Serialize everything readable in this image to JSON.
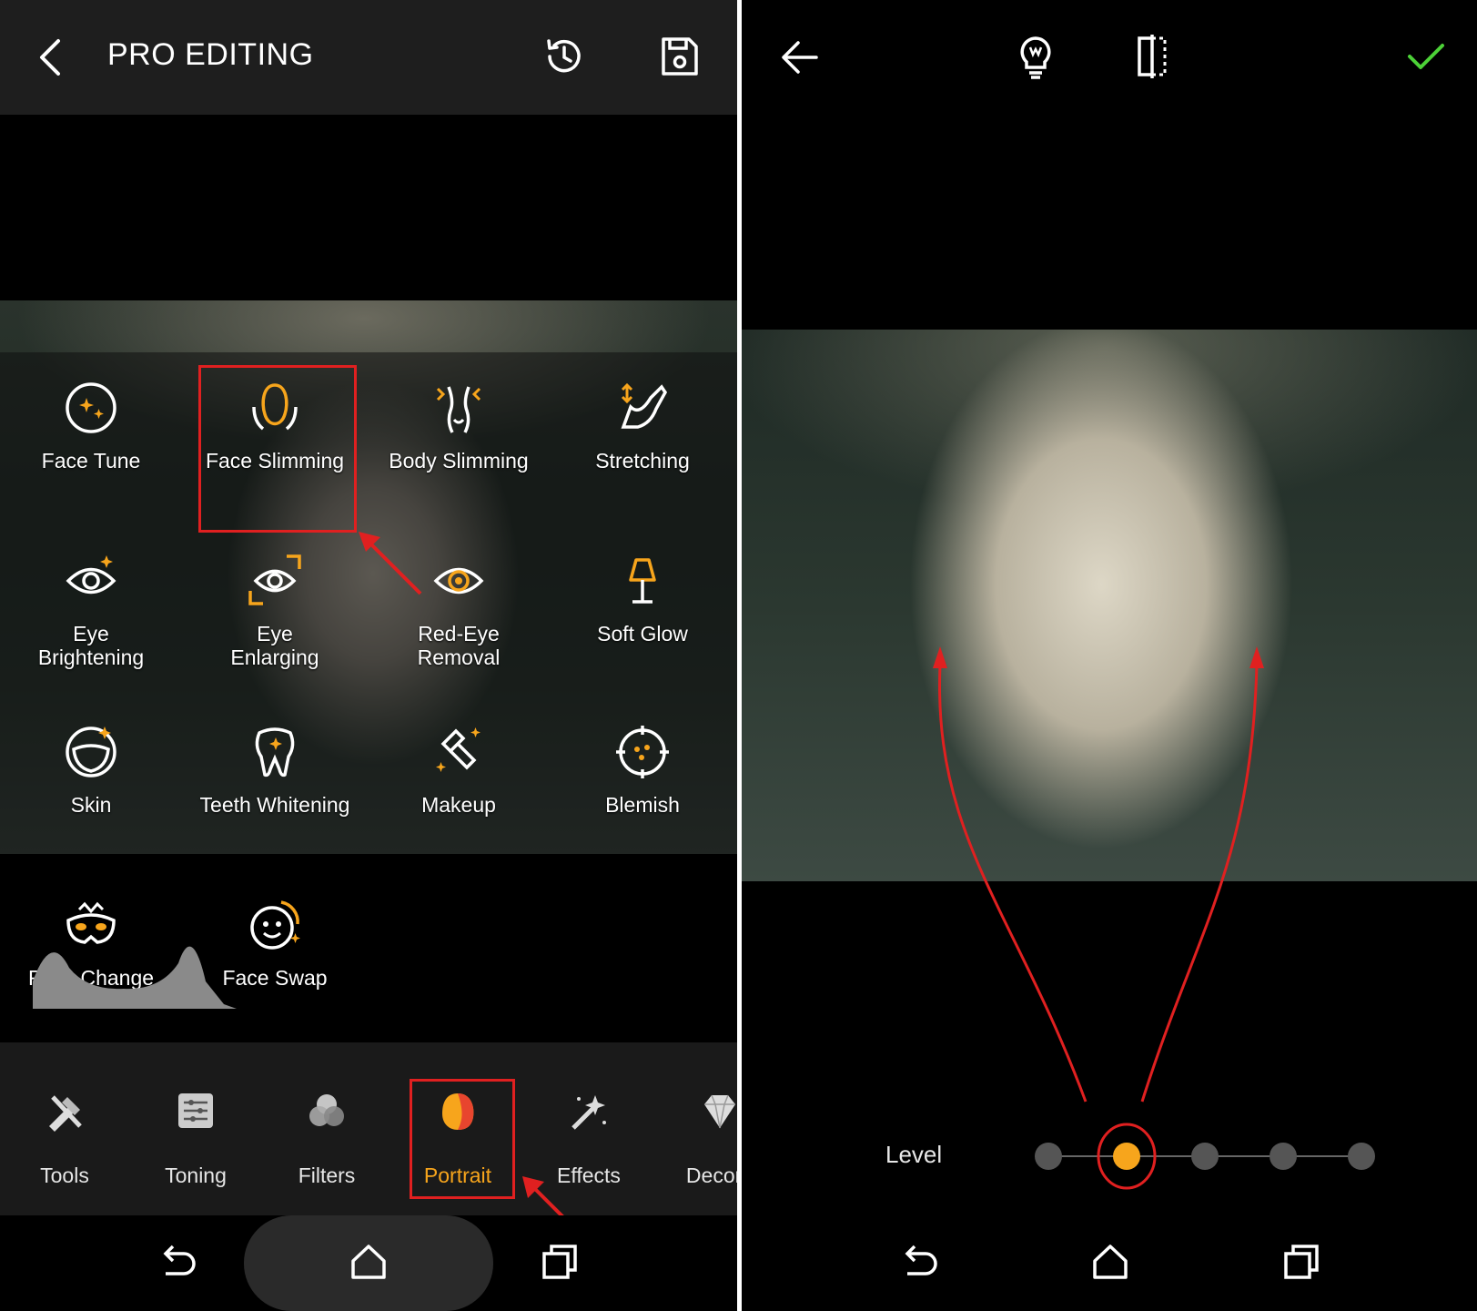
{
  "left": {
    "title": "PRO EDITING",
    "tools": [
      {
        "label": "Face Tune",
        "icon": "face-tune-icon"
      },
      {
        "label": "Face Slimming",
        "icon": "face-slimming-icon"
      },
      {
        "label": "Body Slimming",
        "icon": "body-slimming-icon"
      },
      {
        "label": "Stretching",
        "icon": "stretching-icon"
      },
      {
        "label": "Eye\nBrightening",
        "icon": "eye-brightening-icon"
      },
      {
        "label": "Eye\nEnlarging",
        "icon": "eye-enlarging-icon"
      },
      {
        "label": "Red-Eye\nRemoval",
        "icon": "red-eye-icon"
      },
      {
        "label": "Soft Glow",
        "icon": "lamp-icon"
      },
      {
        "label": "Skin",
        "icon": "skin-icon"
      },
      {
        "label": "Teeth Whitening",
        "icon": "tooth-icon"
      },
      {
        "label": "Makeup",
        "icon": "lipstick-icon"
      },
      {
        "label": "Blemish",
        "icon": "blemish-icon"
      },
      {
        "label": "Face Change",
        "icon": "mask-icon"
      },
      {
        "label": "Face Swap",
        "icon": "face-swap-icon"
      }
    ],
    "tabs": [
      {
        "label": "Tools",
        "icon": "tools-icon"
      },
      {
        "label": "Toning",
        "icon": "sliders-icon"
      },
      {
        "label": "Filters",
        "icon": "filters-icon"
      },
      {
        "label": "Portrait",
        "icon": "portrait-icon",
        "active": true
      },
      {
        "label": "Effects",
        "icon": "magic-wand-icon"
      },
      {
        "label": "Decora",
        "icon": "diamond-icon"
      }
    ],
    "selected_tool": "Face Slimming"
  },
  "right": {
    "level_label": "Level",
    "level_steps": 5,
    "level_selected": 2
  },
  "colors": {
    "accent": "#f7a51c",
    "highlight": "#e02020",
    "confirm": "#4cd137"
  }
}
